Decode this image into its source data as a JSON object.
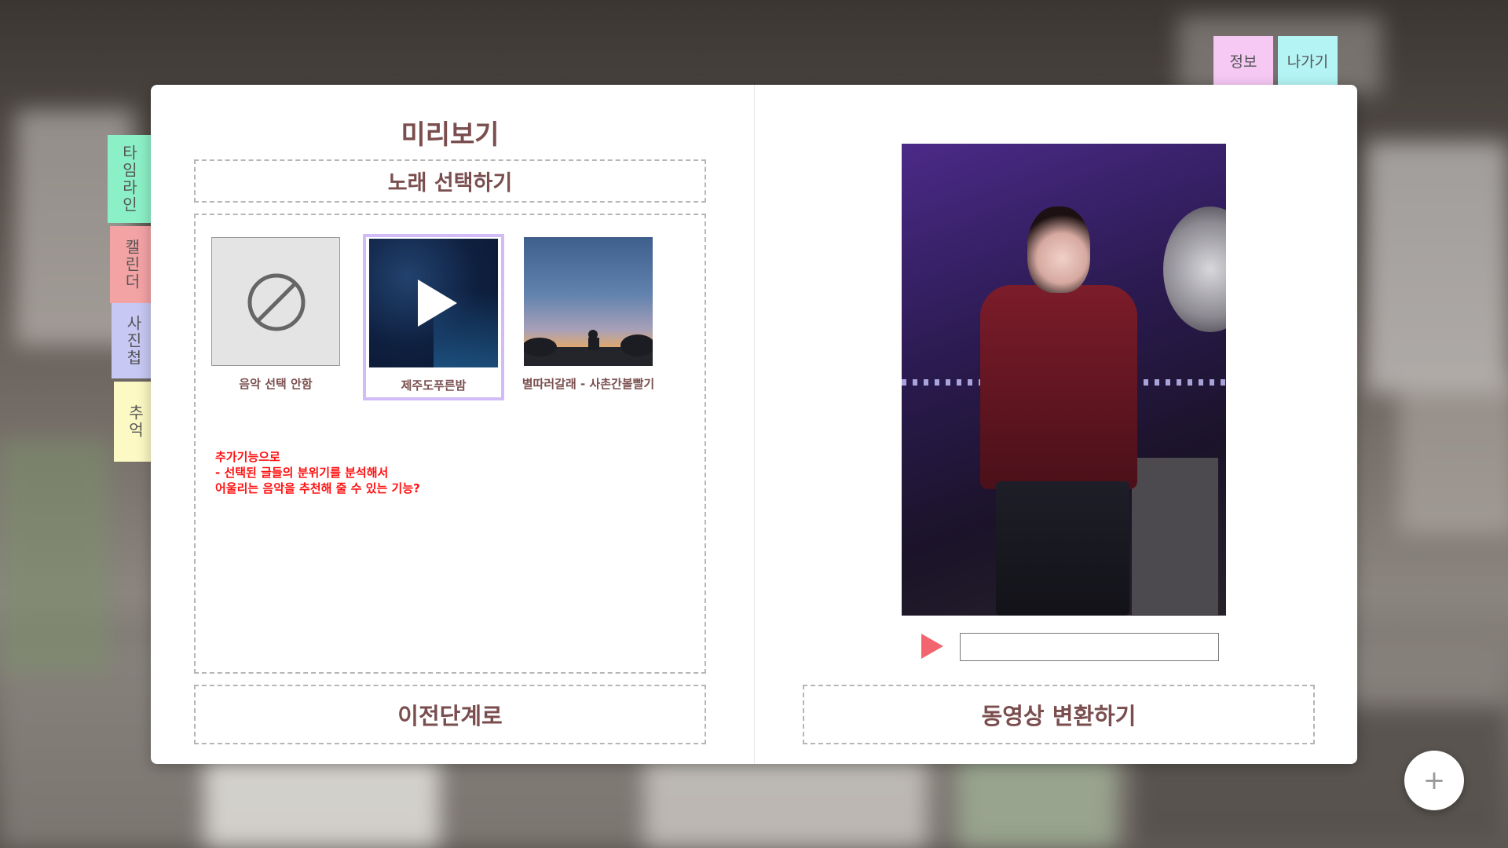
{
  "header": {
    "info_label": "정보",
    "exit_label": "나가기"
  },
  "side_tabs": [
    {
      "label": "타임라인",
      "color": "#8cf0c6"
    },
    {
      "label": "캘린더",
      "color": "#f4a3a5"
    },
    {
      "label": "사진첩",
      "color": "#c7c9f4"
    },
    {
      "label": "추억",
      "color": "#fcf9c4"
    }
  ],
  "preview": {
    "title": "미리보기",
    "select_song_label": "노래 선택하기",
    "music_options": [
      {
        "label": "음악 선택 안함",
        "icon": "ban-icon",
        "selected": false
      },
      {
        "label": "제주도푸른밤",
        "icon": "play-icon",
        "selected": true
      },
      {
        "label": "별따러갈래 - 사촌간볼빨기",
        "icon": "",
        "selected": false
      }
    ],
    "note": "추가기능으로\n- 선택된 글들의 분위기를 분석해서\n어울리는 음악을 추천해 줄 수 있는 기능?",
    "prev_step_label": "이전단계로"
  },
  "video": {
    "progress": 0,
    "convert_label": "동영상 변환하기"
  },
  "fab": {
    "label": "+"
  },
  "colors": {
    "accent_text": "#7a4e4e",
    "note_text": "#ff1111",
    "selected_border": "#d2bcf7",
    "play_button": "#f2656f"
  }
}
